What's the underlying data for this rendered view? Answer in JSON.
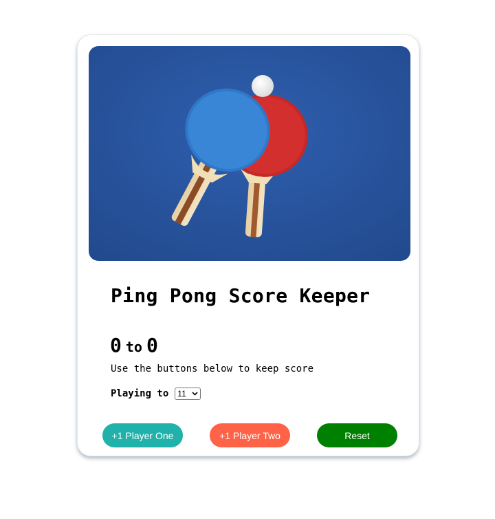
{
  "card": {
    "image_alt": "Two ping pong paddles and a ball on a blue table",
    "title": "Ping Pong Score Keeper",
    "score": {
      "player_one": "0",
      "separator": "to",
      "player_two": "0"
    },
    "hint": "Use the buttons below to keep score",
    "playing_to": {
      "label": "Playing to",
      "selected": "11"
    },
    "buttons": {
      "player_one": "+1 Player One",
      "player_two": "+1 Player Two",
      "reset": "Reset"
    }
  },
  "colors": {
    "player_one_button": "#20b2aa",
    "player_two_button": "#ff6347",
    "reset_button": "#008000",
    "table_blue": "#2a56a0"
  }
}
